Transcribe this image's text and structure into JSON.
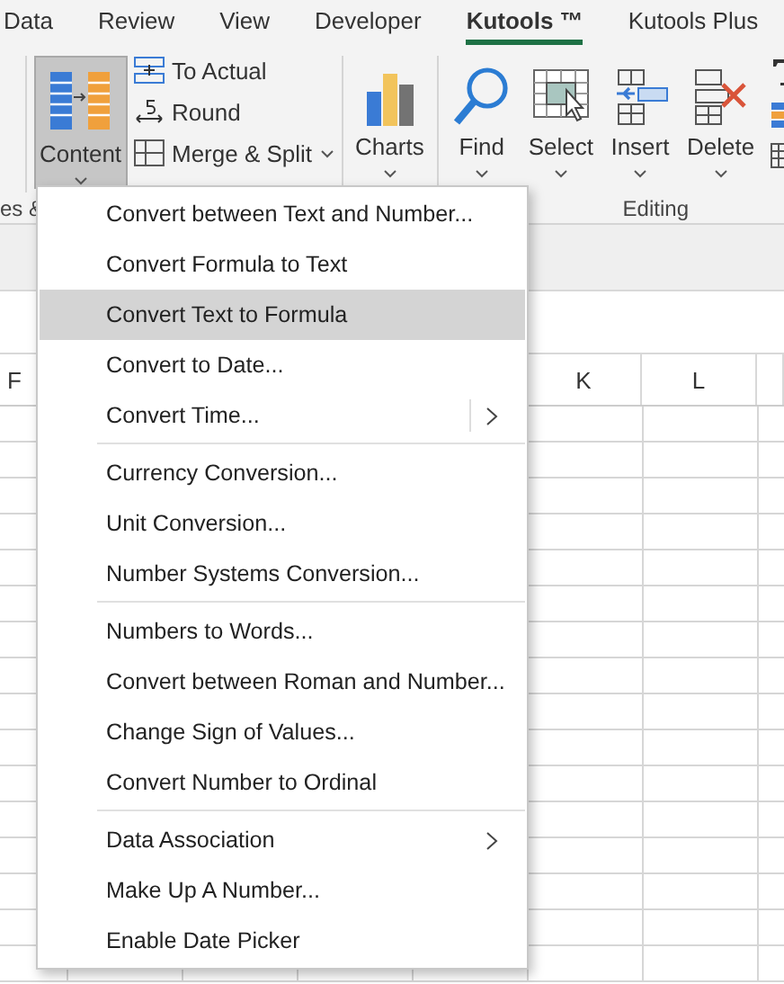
{
  "tabs": [
    {
      "label": "Data",
      "selected": false
    },
    {
      "label": "Review",
      "selected": false
    },
    {
      "label": "View",
      "selected": false
    },
    {
      "label": "Developer",
      "selected": false
    },
    {
      "label": "Kutools ™",
      "selected": true
    },
    {
      "label": "Kutools Plus",
      "selected": false
    }
  ],
  "ribbon": {
    "sections": [
      {
        "items": [
          {
            "kind": "large",
            "label": "Content",
            "pressed": true,
            "dropdown": true
          },
          {
            "kind": "stack",
            "buttons": [
              {
                "label": "To Actual",
                "dropdown": false
              },
              {
                "label": "Round",
                "dropdown": false
              },
              {
                "label": "Merge & Split",
                "dropdown": true
              }
            ]
          }
        ]
      },
      {
        "items": [
          {
            "kind": "large",
            "label": "Charts",
            "pressed": false,
            "dropdown": true
          }
        ]
      },
      {
        "items": [
          {
            "kind": "large",
            "label": "Find",
            "pressed": false,
            "dropdown": true
          },
          {
            "kind": "large",
            "label": "Select",
            "pressed": false,
            "dropdown": true
          },
          {
            "kind": "large",
            "label": "Insert",
            "pressed": false,
            "dropdown": true
          },
          {
            "kind": "large",
            "label": "Delete",
            "pressed": false,
            "dropdown": true
          },
          {
            "kind": "icons"
          }
        ]
      }
    ],
    "group_labels": [
      "es &",
      "Editing"
    ]
  },
  "sheet": {
    "columns": [
      "F",
      "",
      "",
      "",
      "",
      "K",
      "L",
      ""
    ]
  },
  "menu": {
    "groups": [
      {
        "items": [
          {
            "label": "Convert between Text and Number...",
            "kind": "plain",
            "selected": false
          },
          {
            "label": "Convert Formula to Text",
            "kind": "plain",
            "selected": false
          },
          {
            "label": "Convert Text to Formula",
            "kind": "plain",
            "selected": true
          },
          {
            "label": "Convert to Date...",
            "kind": "plain",
            "selected": false
          },
          {
            "label": "Convert Time...",
            "kind": "split",
            "selected": false
          }
        ]
      },
      {
        "items": [
          {
            "label": "Currency Conversion...",
            "kind": "plain",
            "selected": false
          },
          {
            "label": "Unit Conversion...",
            "kind": "plain",
            "selected": false
          },
          {
            "label": "Number Systems Conversion...",
            "kind": "plain",
            "selected": false
          }
        ]
      },
      {
        "items": [
          {
            "label": "Numbers to Words...",
            "kind": "plain",
            "selected": false
          },
          {
            "label": "Convert between Roman and Number...",
            "kind": "plain",
            "selected": false
          },
          {
            "label": "Change Sign of Values...",
            "kind": "plain",
            "selected": false
          },
          {
            "label": "Convert Number to Ordinal",
            "kind": "plain",
            "selected": false
          }
        ]
      },
      {
        "items": [
          {
            "label": "Data Association",
            "kind": "submenu",
            "selected": false
          },
          {
            "label": "Make Up A Number...",
            "kind": "plain",
            "selected": false
          },
          {
            "label": "Enable Date Picker",
            "kind": "plain",
            "selected": false
          }
        ]
      }
    ]
  }
}
